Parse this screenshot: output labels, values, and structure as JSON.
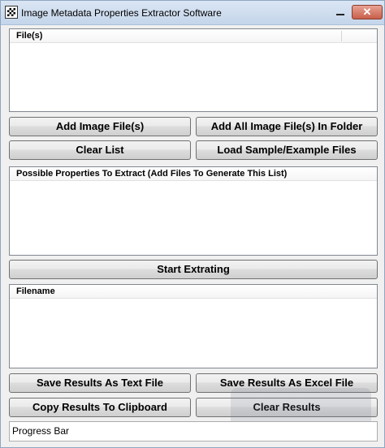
{
  "window": {
    "title": "Image Metadata Properties Extractor Software",
    "close_glyph": "✕"
  },
  "files_panel": {
    "header": "File(s)"
  },
  "buttons": {
    "add_image_files": "Add Image File(s)",
    "add_all_in_folder": "Add All Image File(s) In Folder",
    "clear_list": "Clear List",
    "load_sample": "Load Sample/Example Files",
    "start_extracting": "Start Extrating",
    "save_text": "Save Results As Text File",
    "save_excel": "Save Results As Excel File",
    "copy_clipboard": "Copy Results To Clipboard",
    "clear_results": "Clear Results"
  },
  "properties_panel": {
    "header": "Possible Properties To Extract (Add Files To Generate This List)"
  },
  "results_panel": {
    "header": "Filename"
  },
  "progress_bar": {
    "label": "Progress Bar"
  },
  "icons": {
    "app": "app-icon",
    "minimize": "minimize-icon",
    "close": "close-icon"
  },
  "colors": {
    "titlebar": "#c4d5ea",
    "window_bg": "#f0f0f0",
    "close_button": "#c85f4a"
  }
}
